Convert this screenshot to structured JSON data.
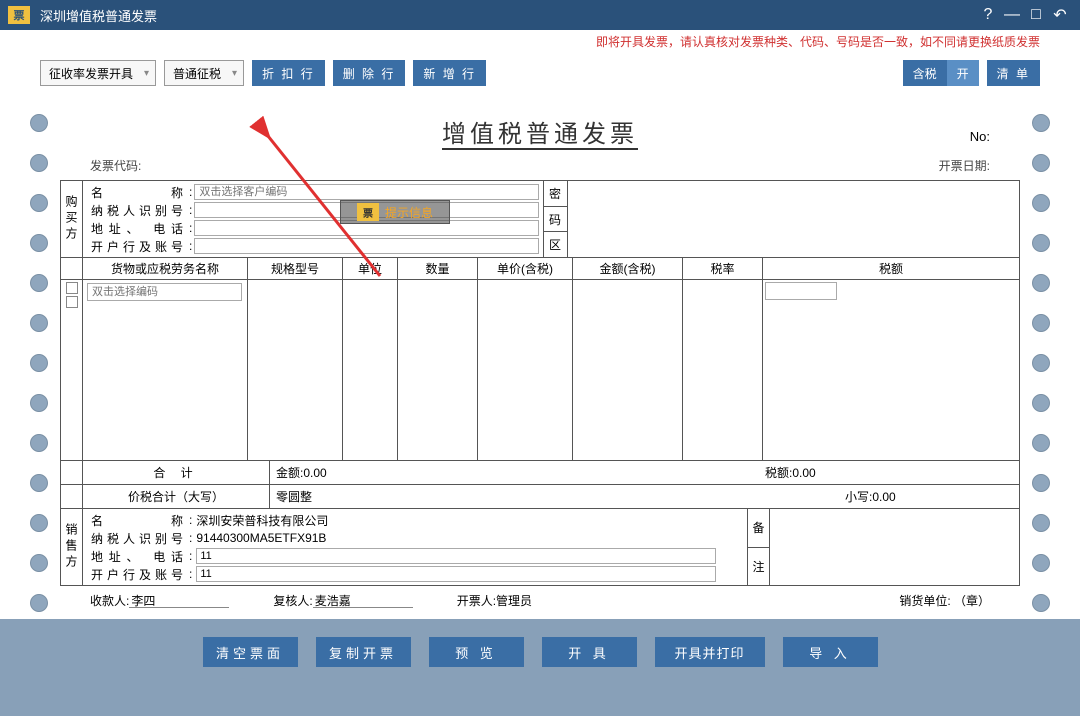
{
  "window": {
    "title": "深圳增值税普通发票"
  },
  "warning": "即将开具发票，请认真核对发票种类、代码、号码是否一致，如不同请更换纸质发票",
  "toolbar": {
    "dropdown1": "征收率发票开具",
    "dropdown2": "普通征税",
    "discount": "折 扣 行",
    "delete": "删 除 行",
    "add": "新 增 行",
    "tax_inc": "含税",
    "on": "开",
    "list": "清  单"
  },
  "invoice": {
    "title": "增值税普通发票",
    "no_label": "No:",
    "code_label": "发票代码:",
    "date_label": "开票日期:",
    "buyer_label": "购买方",
    "seller_label": "销售方",
    "fields": {
      "name": "名        称",
      "taxid": "纳税人识别号",
      "addr": "地址、  电话",
      "bank": "开户行及账号"
    },
    "right_labels": {
      "pwd": "密",
      "code": "码",
      "area": "区",
      "remark": "备",
      "note": "注"
    },
    "name_placeholder": "双击选择客户编码",
    "item_placeholder": "双击选择编码",
    "columns": {
      "name": "货物或应税劳务名称",
      "spec": "规格型号",
      "unit": "单位",
      "qty": "数量",
      "price": "单价(含税)",
      "amount": "金额(含税)",
      "rate": "税率",
      "tax": "税额"
    },
    "totals": {
      "total_label": "合    计",
      "amount": "金额:0.00",
      "tax": "税额:0.00",
      "cap_label": "价税合计（大写）",
      "cap_value": "零圆整",
      "small_label": "小写:0.00"
    },
    "seller": {
      "name": "深圳安荣普科技有限公司",
      "taxid": "91440300MA5ETFX91B",
      "addr": "11",
      "bank": "11"
    },
    "footer": {
      "payee_label": "收款人:",
      "payee": "李四",
      "reviewer_label": "复核人:",
      "reviewer": "麦浩嘉",
      "issuer_label": "开票人:",
      "issuer": "管理员",
      "unit_label": "销货单位:  （章）"
    }
  },
  "overlay": {
    "tip": "提示信息"
  },
  "buttons": {
    "clear": "清空票面",
    "copy": "复制开票",
    "preview": "预  览",
    "issue": "开  具",
    "print": "开具并打印",
    "import": "导  入"
  }
}
